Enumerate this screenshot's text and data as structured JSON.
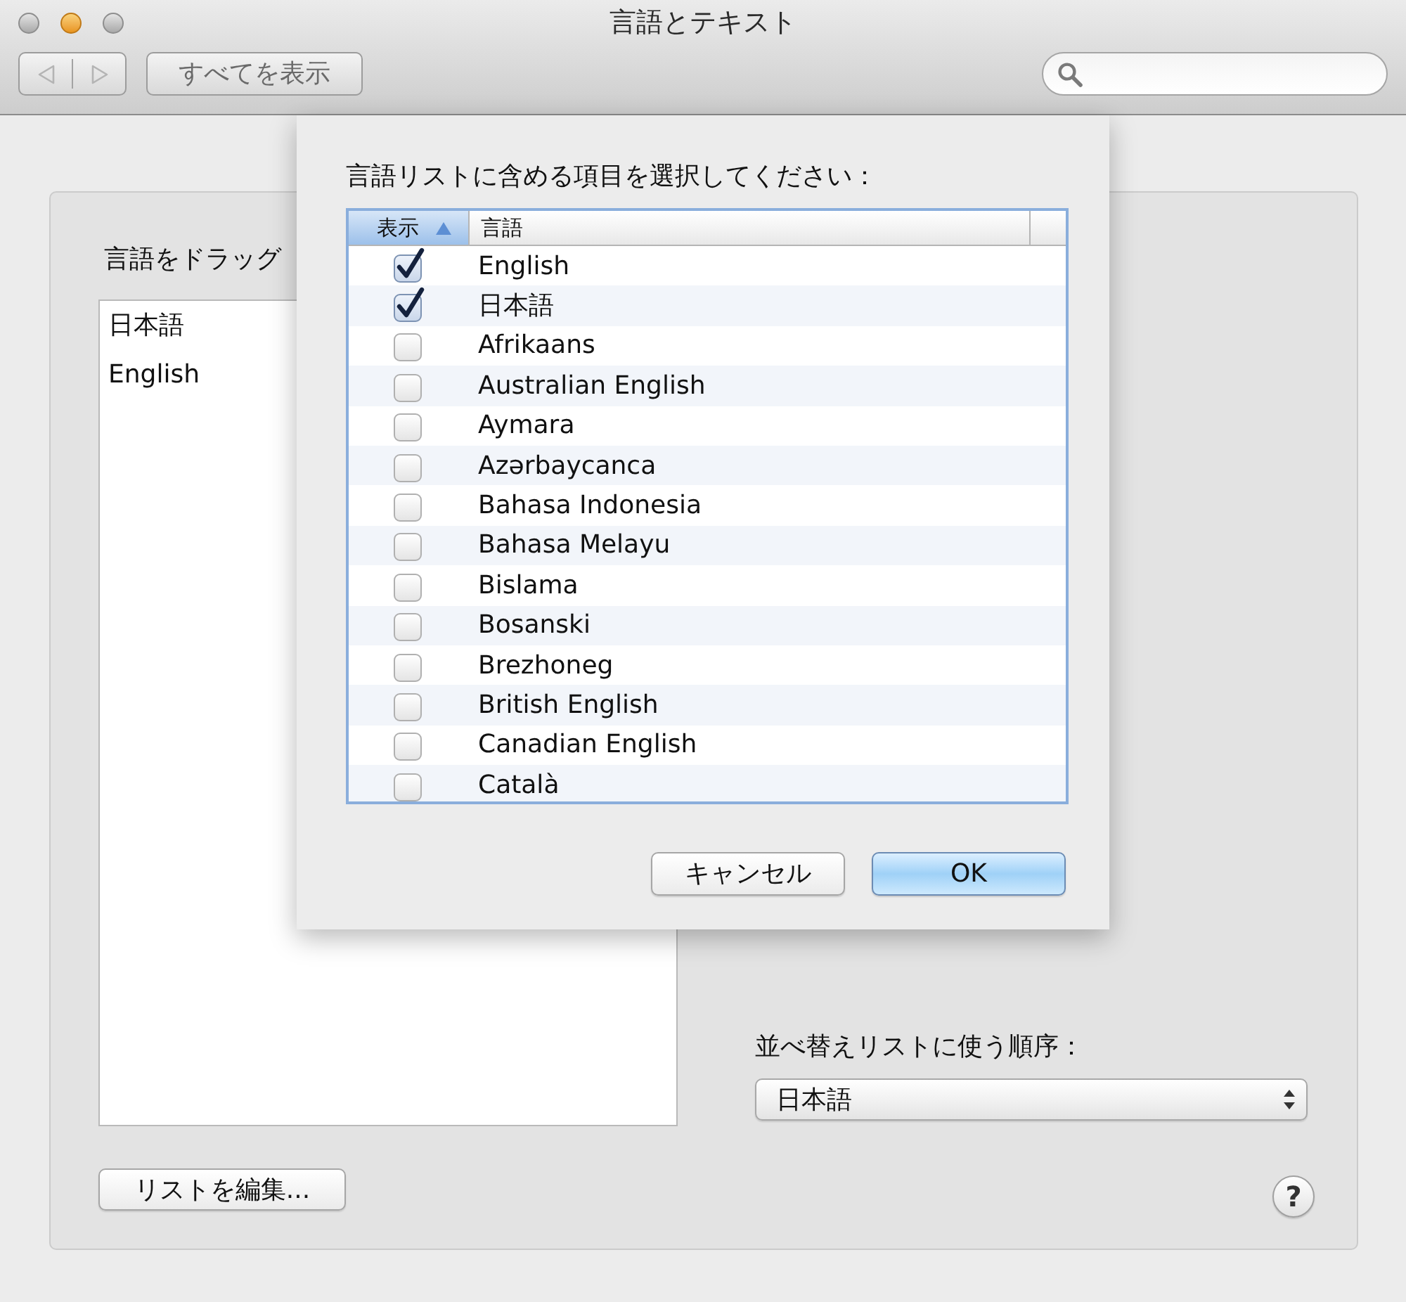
{
  "window": {
    "title": "言語とテキスト",
    "controls": [
      {
        "kind": "close",
        "enabled": false
      },
      {
        "kind": "minimize",
        "enabled": true
      },
      {
        "kind": "zoom",
        "enabled": false
      }
    ]
  },
  "toolbar": {
    "nav": [
      {
        "kind": "back",
        "disabled": true
      },
      {
        "kind": "forward",
        "disabled": true
      }
    ],
    "show_all_button": "すべてを表示"
  },
  "panel": {
    "drag_label": "言語をドラッグ",
    "languages": [
      {
        "name": "日本語"
      },
      {
        "name": "English"
      }
    ],
    "edit_button": "リストを編集...",
    "sort_label": "並べ替えリストに使う順序：",
    "sort_popup": {
      "value": "日本語"
    },
    "help_button": "?"
  },
  "sheet": {
    "prompt": "言語リストに含める項目を選択してください：",
    "columns": [
      {
        "label": "表示",
        "sorted": true
      },
      {
        "label": "言語",
        "sorted": false
      }
    ],
    "rows": [
      {
        "name": "English",
        "checked": true
      },
      {
        "name": "日本語",
        "checked": true
      },
      {
        "name": "Afrikaans",
        "checked": false
      },
      {
        "name": "Australian English",
        "checked": false
      },
      {
        "name": "Aymara",
        "checked": false
      },
      {
        "name": "Azərbaycanca",
        "checked": false
      },
      {
        "name": "Bahasa Indonesia",
        "checked": false
      },
      {
        "name": "Bahasa Melayu",
        "checked": false
      },
      {
        "name": "Bislama",
        "checked": false
      },
      {
        "name": "Bosanski",
        "checked": false
      },
      {
        "name": "Brezhoneg",
        "checked": false
      },
      {
        "name": "British English",
        "checked": false
      },
      {
        "name": "Canadian English",
        "checked": false
      },
      {
        "name": "Català",
        "checked": false
      }
    ],
    "buttons": [
      {
        "label": "キャンセル",
        "default": false
      },
      {
        "label": "OK",
        "default": true
      }
    ]
  }
}
